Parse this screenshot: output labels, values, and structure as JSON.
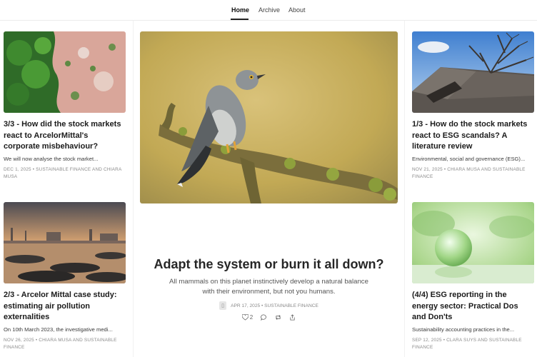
{
  "nav": {
    "items": [
      {
        "label": "Home",
        "active": true
      },
      {
        "label": "Archive",
        "active": false
      },
      {
        "label": "About",
        "active": false
      }
    ]
  },
  "posts": {
    "left_top": {
      "title": "3/3 - How did the stock markets react to ArcelorMittal's corporate misbehaviour?",
      "subtitle": "We will now analyse the stock market...",
      "meta": "DEC 1, 2025 • SUSTAINABLE FINANCE AND CHIARA MUSA",
      "image": "aerial-forest-mine"
    },
    "left_bottom": {
      "title": "2/3 - Arcelor Mittal case study: estimating air pollution externalities",
      "subtitle": "On 10th March 2023, the investigative medi...",
      "meta": "NOV 26, 2025 • CHIARA MUSA AND SUSTAINABLE FINANCE",
      "image": "industrial-coast-sunset"
    },
    "right_top": {
      "title": "1/3 - How do the stock markets react to ESG scandals? A literature review",
      "subtitle": "Environmental, social and governance (ESG)...",
      "meta": "NOV 21, 2025 • CHIARA MUSA AND SUSTAINABLE FINANCE",
      "image": "broken-roof-tree"
    },
    "right_bottom": {
      "title": "(4/4) ESG reporting in the energy sector: Practical Dos and Don'ts",
      "subtitle": "Sustainability accounting practices in the...",
      "meta": "SEP 12, 2025 • CLARA SUYS AND SUSTAINABLE FINANCE",
      "image": "glass-sphere-green"
    }
  },
  "featured": {
    "title": "Adapt the system or burn it all down?",
    "subtitle": "All mammals on this planet instinctively develop a natural balance with their environment, but not you humans.",
    "meta": "APR 17, 2025 • SUSTAINABLE FINANCE",
    "likes": "2",
    "image": "cuckoo-on-mossy-branch"
  },
  "icons": [
    "heart-icon",
    "comment-icon",
    "restack-icon",
    "share-icon"
  ]
}
